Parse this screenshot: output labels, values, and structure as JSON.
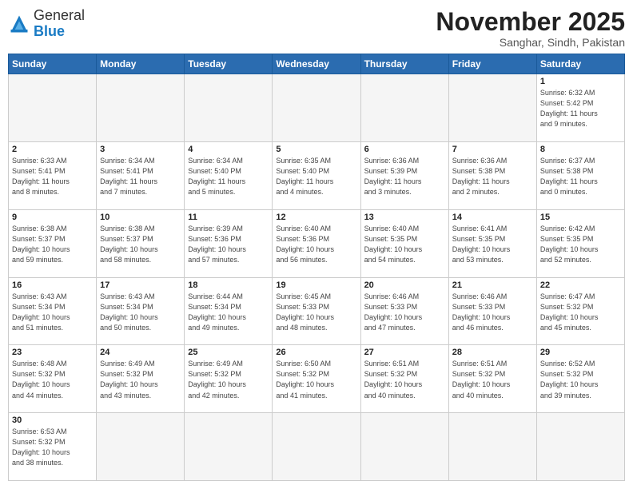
{
  "header": {
    "logo_general": "General",
    "logo_blue": "Blue",
    "month_title": "November 2025",
    "location": "Sanghar, Sindh, Pakistan"
  },
  "weekdays": [
    "Sunday",
    "Monday",
    "Tuesday",
    "Wednesday",
    "Thursday",
    "Friday",
    "Saturday"
  ],
  "weeks": [
    [
      {
        "date": "",
        "info": ""
      },
      {
        "date": "",
        "info": ""
      },
      {
        "date": "",
        "info": ""
      },
      {
        "date": "",
        "info": ""
      },
      {
        "date": "",
        "info": ""
      },
      {
        "date": "",
        "info": ""
      },
      {
        "date": "1",
        "info": "Sunrise: 6:32 AM\nSunset: 5:42 PM\nDaylight: 11 hours\nand 9 minutes."
      }
    ],
    [
      {
        "date": "2",
        "info": "Sunrise: 6:33 AM\nSunset: 5:41 PM\nDaylight: 11 hours\nand 8 minutes."
      },
      {
        "date": "3",
        "info": "Sunrise: 6:34 AM\nSunset: 5:41 PM\nDaylight: 11 hours\nand 7 minutes."
      },
      {
        "date": "4",
        "info": "Sunrise: 6:34 AM\nSunset: 5:40 PM\nDaylight: 11 hours\nand 5 minutes."
      },
      {
        "date": "5",
        "info": "Sunrise: 6:35 AM\nSunset: 5:40 PM\nDaylight: 11 hours\nand 4 minutes."
      },
      {
        "date": "6",
        "info": "Sunrise: 6:36 AM\nSunset: 5:39 PM\nDaylight: 11 hours\nand 3 minutes."
      },
      {
        "date": "7",
        "info": "Sunrise: 6:36 AM\nSunset: 5:38 PM\nDaylight: 11 hours\nand 2 minutes."
      },
      {
        "date": "8",
        "info": "Sunrise: 6:37 AM\nSunset: 5:38 PM\nDaylight: 11 hours\nand 0 minutes."
      }
    ],
    [
      {
        "date": "9",
        "info": "Sunrise: 6:38 AM\nSunset: 5:37 PM\nDaylight: 10 hours\nand 59 minutes."
      },
      {
        "date": "10",
        "info": "Sunrise: 6:38 AM\nSunset: 5:37 PM\nDaylight: 10 hours\nand 58 minutes."
      },
      {
        "date": "11",
        "info": "Sunrise: 6:39 AM\nSunset: 5:36 PM\nDaylight: 10 hours\nand 57 minutes."
      },
      {
        "date": "12",
        "info": "Sunrise: 6:40 AM\nSunset: 5:36 PM\nDaylight: 10 hours\nand 56 minutes."
      },
      {
        "date": "13",
        "info": "Sunrise: 6:40 AM\nSunset: 5:35 PM\nDaylight: 10 hours\nand 54 minutes."
      },
      {
        "date": "14",
        "info": "Sunrise: 6:41 AM\nSunset: 5:35 PM\nDaylight: 10 hours\nand 53 minutes."
      },
      {
        "date": "15",
        "info": "Sunrise: 6:42 AM\nSunset: 5:35 PM\nDaylight: 10 hours\nand 52 minutes."
      }
    ],
    [
      {
        "date": "16",
        "info": "Sunrise: 6:43 AM\nSunset: 5:34 PM\nDaylight: 10 hours\nand 51 minutes."
      },
      {
        "date": "17",
        "info": "Sunrise: 6:43 AM\nSunset: 5:34 PM\nDaylight: 10 hours\nand 50 minutes."
      },
      {
        "date": "18",
        "info": "Sunrise: 6:44 AM\nSunset: 5:34 PM\nDaylight: 10 hours\nand 49 minutes."
      },
      {
        "date": "19",
        "info": "Sunrise: 6:45 AM\nSunset: 5:33 PM\nDaylight: 10 hours\nand 48 minutes."
      },
      {
        "date": "20",
        "info": "Sunrise: 6:46 AM\nSunset: 5:33 PM\nDaylight: 10 hours\nand 47 minutes."
      },
      {
        "date": "21",
        "info": "Sunrise: 6:46 AM\nSunset: 5:33 PM\nDaylight: 10 hours\nand 46 minutes."
      },
      {
        "date": "22",
        "info": "Sunrise: 6:47 AM\nSunset: 5:32 PM\nDaylight: 10 hours\nand 45 minutes."
      }
    ],
    [
      {
        "date": "23",
        "info": "Sunrise: 6:48 AM\nSunset: 5:32 PM\nDaylight: 10 hours\nand 44 minutes."
      },
      {
        "date": "24",
        "info": "Sunrise: 6:49 AM\nSunset: 5:32 PM\nDaylight: 10 hours\nand 43 minutes."
      },
      {
        "date": "25",
        "info": "Sunrise: 6:49 AM\nSunset: 5:32 PM\nDaylight: 10 hours\nand 42 minutes."
      },
      {
        "date": "26",
        "info": "Sunrise: 6:50 AM\nSunset: 5:32 PM\nDaylight: 10 hours\nand 41 minutes."
      },
      {
        "date": "27",
        "info": "Sunrise: 6:51 AM\nSunset: 5:32 PM\nDaylight: 10 hours\nand 40 minutes."
      },
      {
        "date": "28",
        "info": "Sunrise: 6:51 AM\nSunset: 5:32 PM\nDaylight: 10 hours\nand 40 minutes."
      },
      {
        "date": "29",
        "info": "Sunrise: 6:52 AM\nSunset: 5:32 PM\nDaylight: 10 hours\nand 39 minutes."
      }
    ],
    [
      {
        "date": "30",
        "info": "Sunrise: 6:53 AM\nSunset: 5:32 PM\nDaylight: 10 hours\nand 38 minutes."
      },
      {
        "date": "",
        "info": ""
      },
      {
        "date": "",
        "info": ""
      },
      {
        "date": "",
        "info": ""
      },
      {
        "date": "",
        "info": ""
      },
      {
        "date": "",
        "info": ""
      },
      {
        "date": "",
        "info": ""
      }
    ]
  ]
}
